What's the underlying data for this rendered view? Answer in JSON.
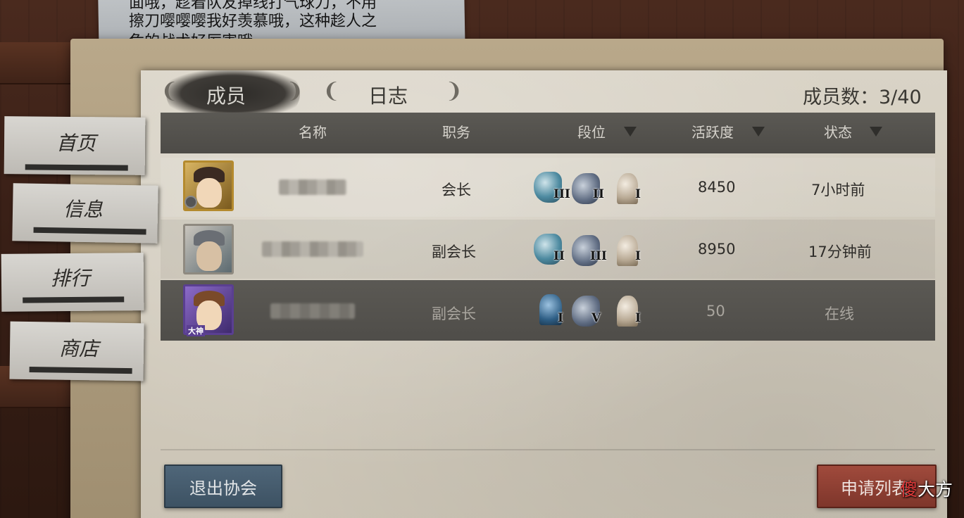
{
  "note": {
    "line1": "面哦，趁着队友掉线打气球刀，不用",
    "line2": "擦刀嘤嘤嘤我好羡慕哦，这种趁人之",
    "line3": "危的战术好厉害哦"
  },
  "tabs": [
    {
      "label": "成员",
      "active": true
    },
    {
      "label": "日志",
      "active": false
    }
  ],
  "member_count": "成员数：3/40",
  "table": {
    "headers": [
      "名称",
      "职务",
      "段位",
      "活跃度",
      "状态"
    ],
    "rows": [
      {
        "role": "会长",
        "ranks": [
          {
            "icon": "hunter-rank-icon",
            "tier": "III"
          },
          {
            "icon": "survivor-rank-icon",
            "tier": "II"
          },
          {
            "icon": "knight-rank-icon",
            "tier": "I"
          }
        ],
        "activity": "8450",
        "status": "7小时前"
      },
      {
        "role": "副会长",
        "ranks": [
          {
            "icon": "hunter-rank-icon",
            "tier": "II"
          },
          {
            "icon": "survivor-rank-icon",
            "tier": "III"
          },
          {
            "icon": "knight-rank-icon",
            "tier": "I"
          }
        ],
        "activity": "8950",
        "status": "17分钟前"
      },
      {
        "role": "副会长",
        "avatar_badge": "大神",
        "ranks": [
          {
            "icon": "anubis-rank-icon",
            "tier": "I"
          },
          {
            "icon": "survivor-rank-icon",
            "tier": "V"
          },
          {
            "icon": "knight-rank-icon",
            "tier": "I"
          }
        ],
        "activity": "50",
        "status": "在线"
      }
    ]
  },
  "sidebar": {
    "items": [
      {
        "label": "首页"
      },
      {
        "label": "信息"
      },
      {
        "label": "排行"
      },
      {
        "label": "商店"
      }
    ]
  },
  "buttons": {
    "leave": "退出协会",
    "apply_list": "申请列表"
  },
  "watermark": {
    "first": "傻",
    "rest": "大方"
  },
  "colors": {
    "header_bg": "#5b5954",
    "leave_button": "#4f6679",
    "apply_button": "#a04a3c",
    "panel": "#d9d3c6"
  }
}
